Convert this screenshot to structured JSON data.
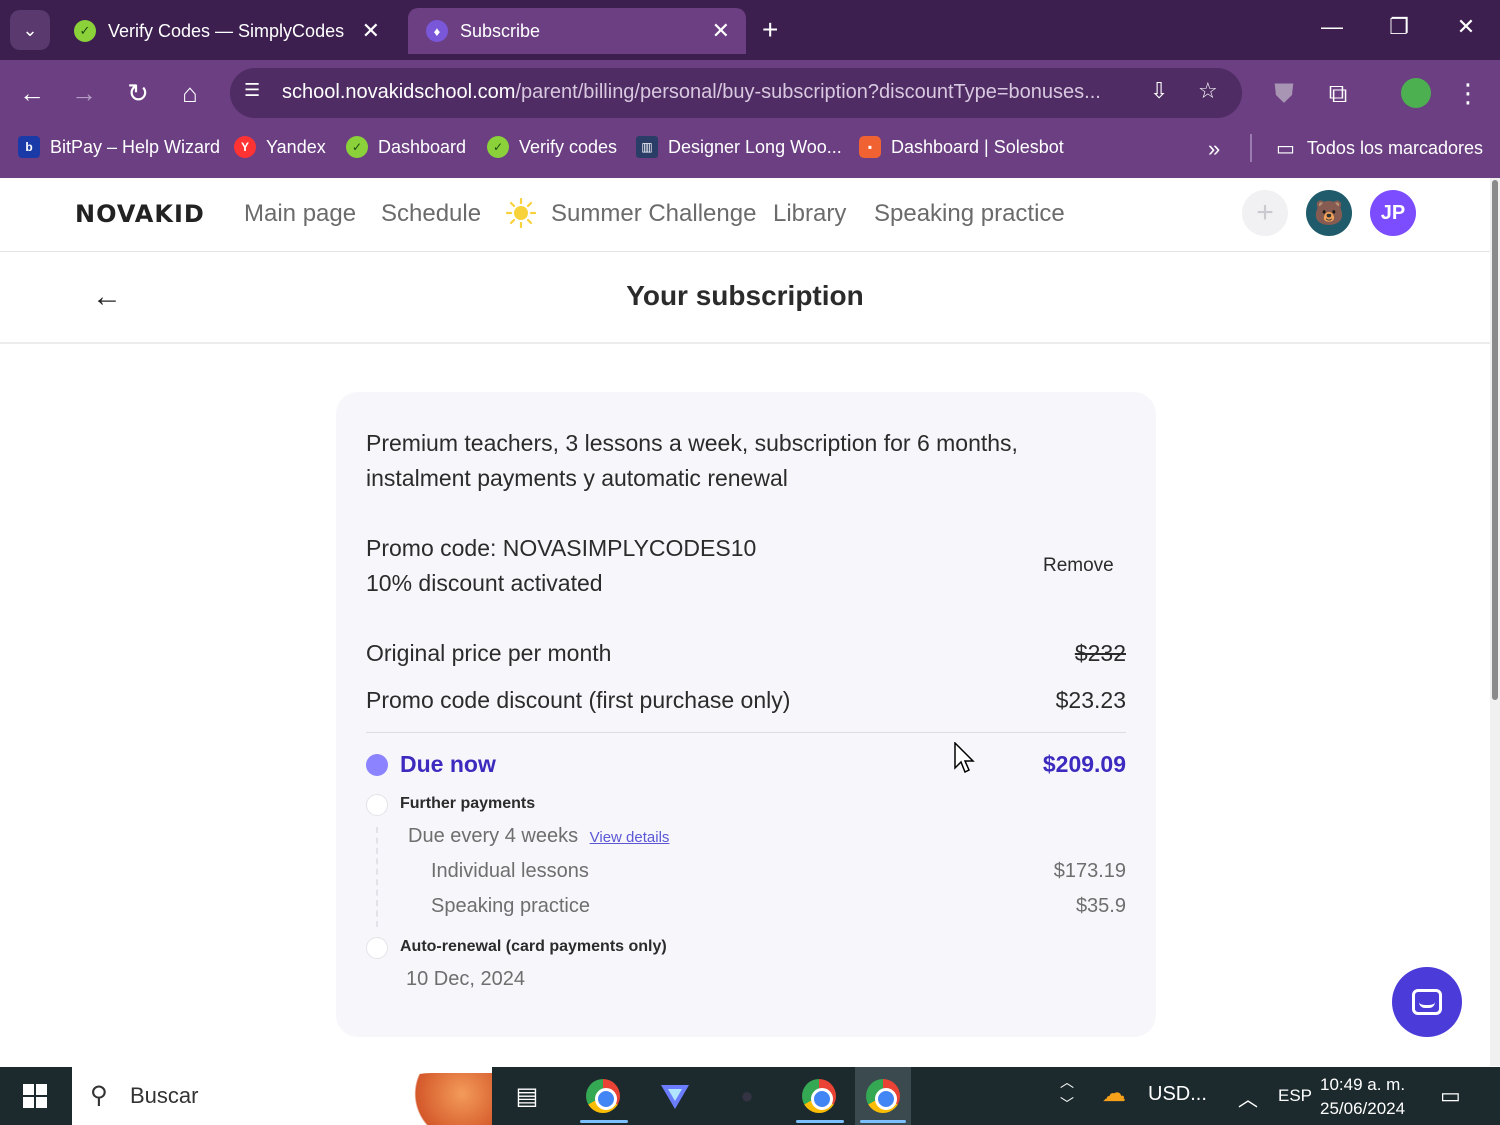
{
  "browser": {
    "tabs": [
      {
        "title": "Verify Codes — SimplyCodes",
        "active": false
      },
      {
        "title": "Subscribe",
        "active": true
      }
    ],
    "url_host": "school.novakidschool.com",
    "url_path": "/parent/billing/personal/buy-subscription?discountType=bonuses...",
    "bookmarks": [
      {
        "label": "BitPay – Help Wizard",
        "icon": "bitpay-icon"
      },
      {
        "label": "Yandex",
        "icon": "yandex-icon"
      },
      {
        "label": "Dashboard",
        "icon": "simplycodes-icon"
      },
      {
        "label": "Verify codes",
        "icon": "simplycodes-icon"
      },
      {
        "label": "Designer Long Woo...",
        "icon": "building-icon"
      },
      {
        "label": "Dashboard | Solesbot",
        "icon": "solesbot-icon"
      }
    ],
    "all_bookmarks": "Todos los marcadores"
  },
  "site": {
    "logo": "NOVAKID",
    "nav": [
      "Main page",
      "Schedule",
      "Summer Challenge",
      "Library",
      "Speaking practice"
    ],
    "user_initials": "JP"
  },
  "page": {
    "title": "Your subscription"
  },
  "subscription": {
    "description_line1": "Premium teachers, 3 lessons a week, subscription for 6 months,",
    "description_line2": "instalment payments y automatic renewal",
    "promo_code_line": "Promo code: NOVASIMPLYCODES10",
    "promo_status": "10% discount activated",
    "remove_label": "Remove",
    "original_price_label": "Original price per month",
    "original_price_value": "$232",
    "promo_discount_label": "Promo code discount (first purchase only)",
    "promo_discount_value": "$23.23",
    "due_now_label": "Due now",
    "due_now_value": "$209.09",
    "further_payments_label": "Further payments",
    "due_every_label": "Due every 4 weeks",
    "view_details_label": "View details",
    "individual_lessons_label": "Individual lessons",
    "individual_lessons_value": "$173.19",
    "speaking_practice_label": "Speaking practice",
    "speaking_practice_value": "$35.9",
    "auto_renewal_label": "Auto-renewal (card payments only)",
    "auto_renewal_date": "10 Dec, 2024"
  },
  "taskbar": {
    "search_placeholder": "Buscar",
    "weather_label": "USD...",
    "language": "ESP",
    "time": "10:49 a. m.",
    "date": "25/06/2024"
  },
  "colors": {
    "browser_frame": "#3c1f4f",
    "browser_toolbar": "#6b3f82",
    "accent": "#4b3bd9",
    "due_now": "#3d2bbf"
  }
}
